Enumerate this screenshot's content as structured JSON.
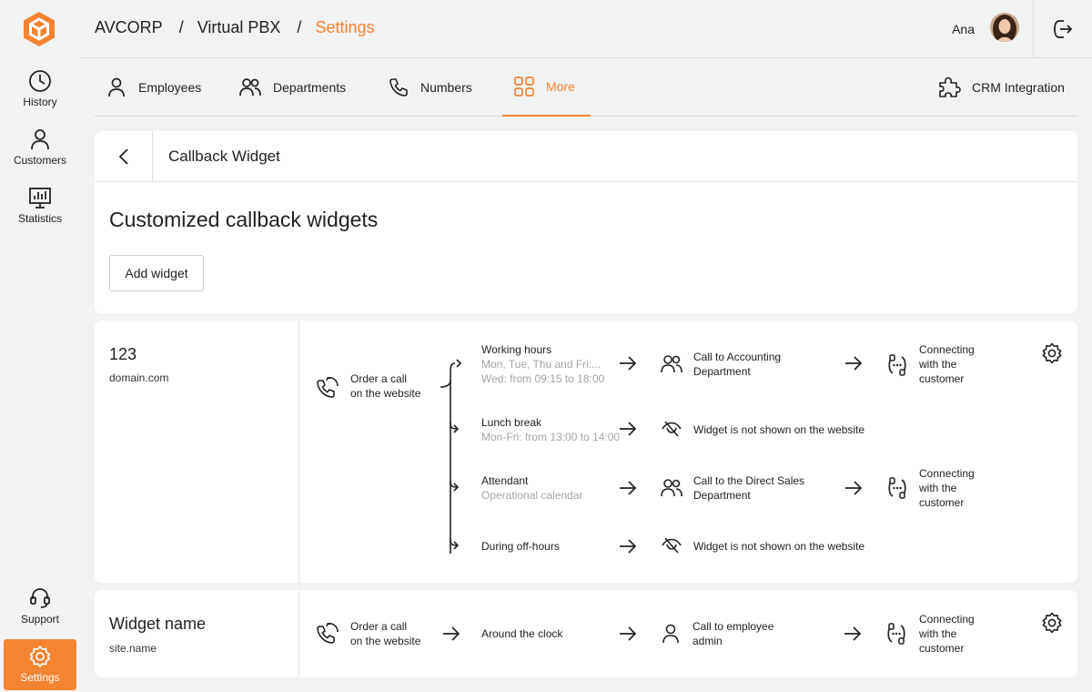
{
  "sidebar": {
    "items": [
      {
        "label": "History",
        "icon": "clock-icon"
      },
      {
        "label": "Customers",
        "icon": "person-icon"
      },
      {
        "label": "Statistics",
        "icon": "chart-icon"
      }
    ],
    "support_label": "Support",
    "settings_label": "Settings"
  },
  "header": {
    "crumbs": [
      "AVCORP",
      "/",
      "Virtual PBX",
      "/",
      "Settings"
    ],
    "user_name": "Ana"
  },
  "tabs": [
    {
      "label": "Employees",
      "icon": "person-icon"
    },
    {
      "label": "Departments",
      "icon": "group-icon"
    },
    {
      "label": "Numbers",
      "icon": "phone-icon"
    },
    {
      "label": "More",
      "icon": "grid-icon",
      "active": true
    },
    {
      "label": "CRM Integration",
      "icon": "puzzle-icon"
    }
  ],
  "panel": {
    "title": "Callback Widget",
    "heading": "Customized callback widgets",
    "add_button": "Add widget"
  },
  "widgets": [
    {
      "name": "123",
      "domain": "domain.com",
      "trigger": [
        "Order a call",
        "on the website"
      ],
      "branches": [
        {
          "title": "Working hours",
          "sub": [
            "Mon, Tue, Thu and Fri:...",
            "Wed: from 09:15 to 18:00"
          ],
          "action": [
            "Call to Accounting",
            "Department"
          ],
          "result": [
            "Connecting",
            "with the",
            "customer"
          ]
        },
        {
          "title": "Lunch break",
          "sub": [
            "Mon-Fri: from 13:00 to 14:00"
          ],
          "action": [
            "Widget is not shown on the website"
          ]
        },
        {
          "title": "Attendant",
          "sub": [
            "Operational calendar"
          ],
          "action": [
            "Call to the Direct Sales",
            "Department"
          ],
          "result": [
            "Connecting",
            "with the",
            "customer"
          ]
        },
        {
          "title": "During off-hours",
          "action": [
            "Widget is not shown on the website"
          ]
        }
      ]
    },
    {
      "name": "Widget name",
      "domain": "site.name",
      "trigger": [
        "Order a call",
        "on the website"
      ],
      "schedule": "Around the clock",
      "action": [
        "Call to employee",
        "admin"
      ],
      "result": [
        "Connecting",
        "with the",
        "customer"
      ]
    }
  ],
  "colors": {
    "accent": "#f48432",
    "text": "#222222",
    "muted": "#a5a5a5",
    "background": "#f1f2f2"
  }
}
